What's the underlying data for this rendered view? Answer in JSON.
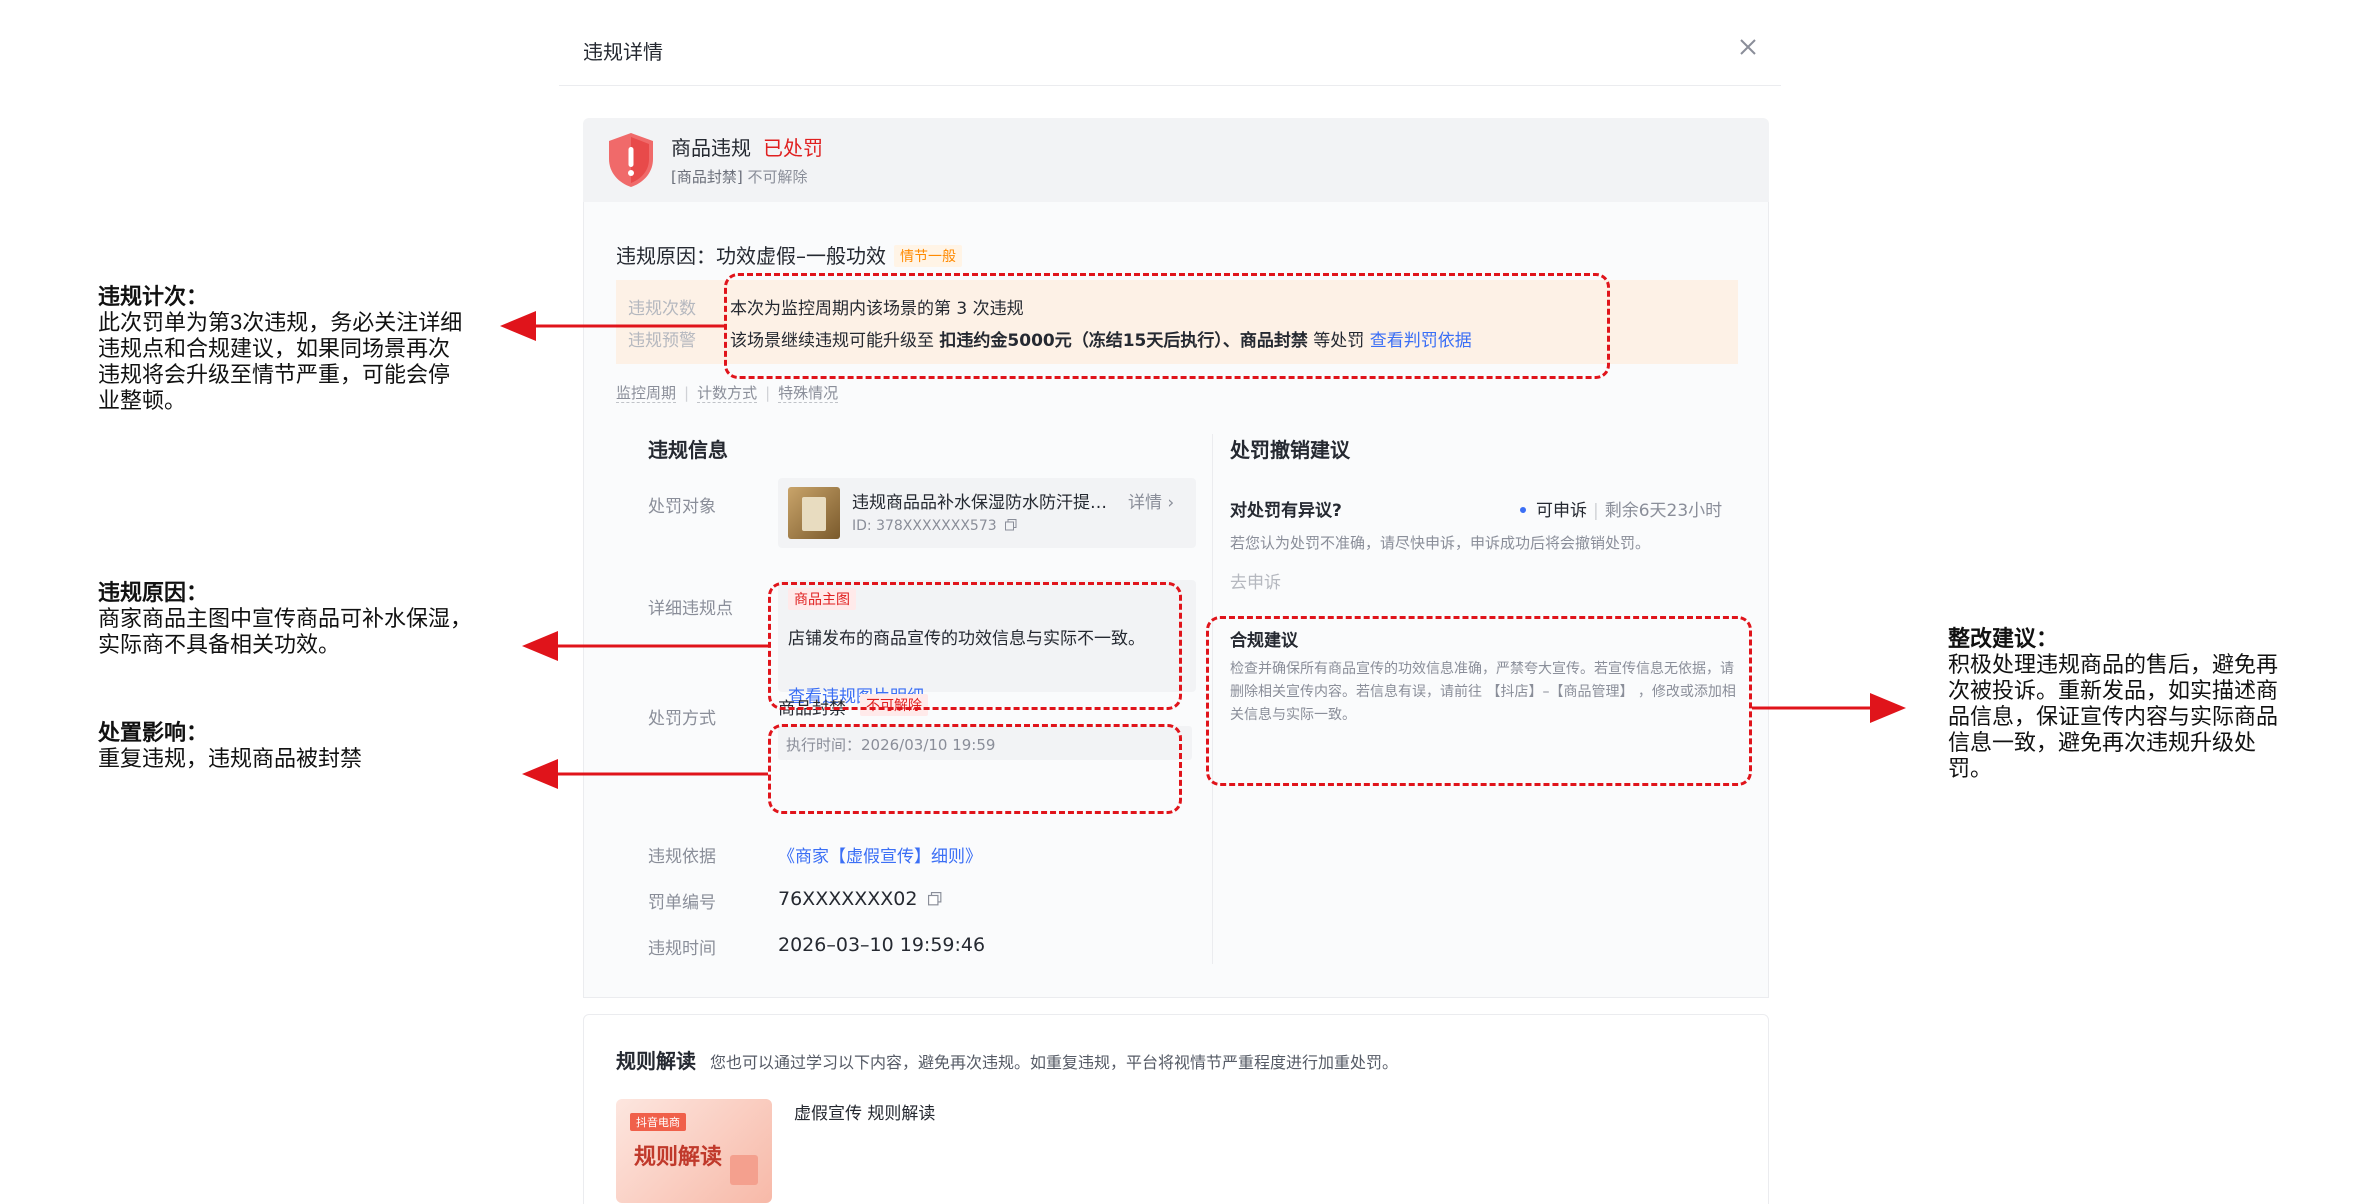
{
  "modal": {
    "title": "违规详情"
  },
  "status": {
    "title": "商品违规",
    "tag": "已处罚",
    "sub_bracket": "[商品封禁]",
    "sub_note": "不可解除"
  },
  "reason": {
    "label": "违规原因：功效虚假–一般功效",
    "badge": "情节一般"
  },
  "warning": {
    "count_label": "违规次数",
    "count_text": "本次为监控周期内该场景的第 3 次违规",
    "alert_label": "违规预警",
    "alert_text_prefix": "该场景继续违规可能升级至 ",
    "alert_text_bold": "扣违约金5000元（冻结15天后执行）、商品封禁",
    "alert_text_suffix": " 等处罚 ",
    "alert_link": "查看判罚依据"
  },
  "help_links": [
    "监控周期",
    "计数方式",
    "特殊情况"
  ],
  "violation_info": {
    "section_title": "违规信息",
    "target_label": "处罚对象",
    "product_name": "违规商品品补水保湿防水防汗提…",
    "product_detail": "详情",
    "product_id": "ID: 378XXXXXXX573",
    "detail_label": "详细违规点",
    "detail_tag": "商品主图",
    "detail_text": "店铺发布的商品宣传的功效信息与实际不一致。",
    "detail_link": "查看违规图片明细",
    "method_label": "处罚方式",
    "method_name": "商品封禁",
    "method_tag": "不可解除",
    "method_time": "执行时间：2026/03/10 19:59",
    "basis_label": "违规依据",
    "basis_link": "《商家【虚假宣传】细则》",
    "order_label": "罚单编号",
    "order_no": "76XXXXXXX02",
    "time_label": "违规时间",
    "time_value": "2026–03–10 19:59:46"
  },
  "revoke": {
    "section_title": "处罚撤销建议",
    "question": "对处罚有异议?",
    "status": "可申诉",
    "remain": "剩余6天23小时",
    "desc": "若您认为处罚不准确，请尽快申诉，申诉成功后将会撤销处罚。",
    "appeal_button": "去申诉",
    "compliance_title": "合规建议",
    "compliance_text": "检查并确保所有商品宣传的功效信息准确，严禁夸大宣传。若宣传信息无依据，请删除相关宣传内容。若信息有误，请前往 【抖店】–【商品管理】 ，修改或添加相关信息与实际一致。"
  },
  "rules": {
    "title": "规则解读",
    "desc": "您也可以通过学习以下内容，避免再次违规。如重复违规，平台将视情节严重程度进行加重处罚。",
    "thumb_brand": "抖音电商",
    "thumb_text": "规则解读",
    "item_title": "虚假宣传 规则解读"
  },
  "annotations": {
    "count": {
      "title": "违规计次：",
      "lines": [
        "此次罚单为第3次违规，务必关注详细",
        "违规点和合规建议，如果同场景再次",
        "违规将会升级至情节严重，可能会停",
        "业整顿。"
      ]
    },
    "reason": {
      "title": "违规原因：",
      "lines": [
        "商家商品主图中宣传商品可补水保湿，",
        "实际商不具备相关功效。"
      ]
    },
    "impact": {
      "title": "处置影响：",
      "lines": [
        "重复违规，违规商品被封禁"
      ]
    },
    "advice": {
      "title": "整改建议：",
      "lines": [
        "积极处理违规商品的售后，避免再",
        "次被投诉。重新发品，如实描述商",
        "品信息，保证宣传内容与实际商品",
        "信息一致，避免再次违规升级处",
        "罚。"
      ]
    }
  },
  "colors": {
    "alert_red": "#e02020",
    "link_blue": "#3b6ff5",
    "warning_bg": "#fdf1e6",
    "annotation_red": "#e0141b"
  }
}
